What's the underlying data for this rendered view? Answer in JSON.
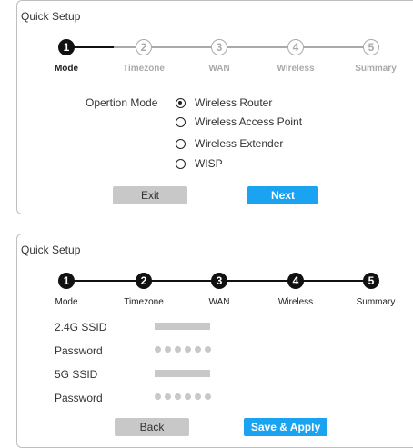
{
  "panel1": {
    "title": "Quick Setup",
    "steps": [
      {
        "num": "1",
        "label": "Mode"
      },
      {
        "num": "2",
        "label": "Timezone"
      },
      {
        "num": "3",
        "label": "WAN"
      },
      {
        "num": "4",
        "label": "Wireless"
      },
      {
        "num": "5",
        "label": "Summary"
      }
    ],
    "mode_label": "Opertion Mode",
    "options": [
      {
        "label": "Wireless Router",
        "checked": true
      },
      {
        "label": "Wireless Access Point",
        "checked": false
      },
      {
        "label": "Wireless Extender",
        "checked": false
      },
      {
        "label": "WISP",
        "checked": false
      }
    ],
    "exit_label": "Exit",
    "next_label": "Next"
  },
  "panel2": {
    "title": "Quick Setup",
    "steps": [
      {
        "num": "1",
        "label": "Mode"
      },
      {
        "num": "2",
        "label": "Timezone"
      },
      {
        "num": "3",
        "label": "WAN"
      },
      {
        "num": "4",
        "label": "Wireless"
      },
      {
        "num": "5",
        "label": "Summary"
      }
    ],
    "fields": [
      {
        "label": "2.4G SSID"
      },
      {
        "label": "Password"
      },
      {
        "label": "5G SSID"
      },
      {
        "label": "Password"
      }
    ],
    "back_label": "Back",
    "apply_label": "Save & Apply"
  },
  "colors": {
    "accent": "#1aa3f0",
    "active_step": "#111111",
    "inactive_step": "#aaaaaa",
    "button_gray": "#c8c8c8"
  }
}
